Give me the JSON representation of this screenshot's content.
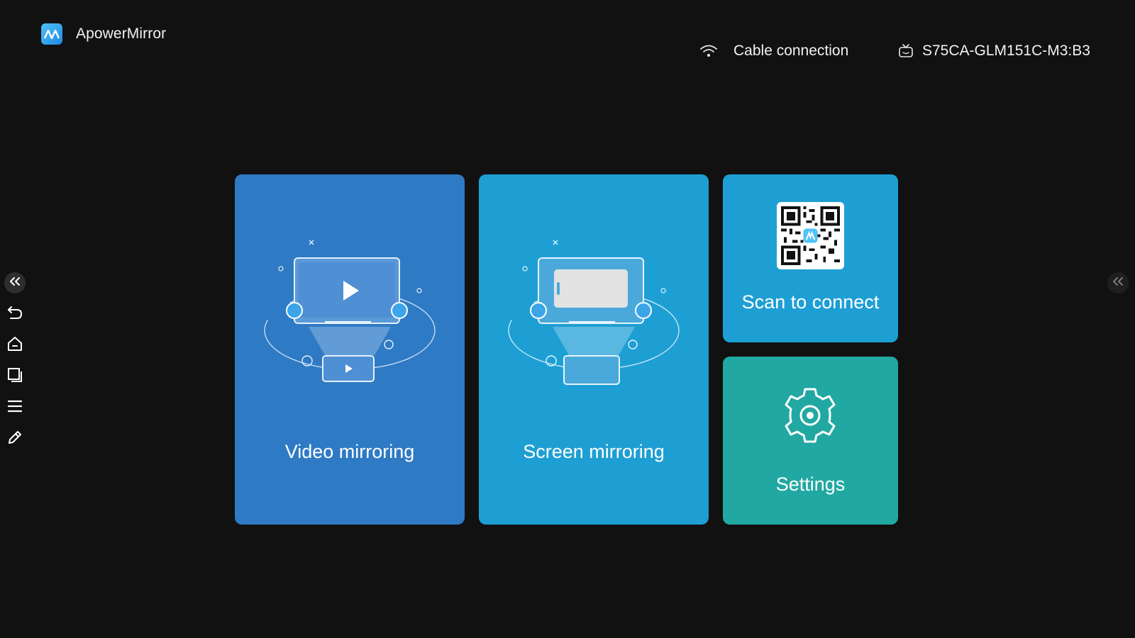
{
  "app": {
    "title": "ApowerMirror",
    "logo_icon": "apowermirror-logo-icon"
  },
  "status": {
    "connection_label": "Cable connection",
    "connection_icon": "wifi-icon",
    "device_name": "S75CA-GLM151C-M3:B3",
    "device_icon": "tv-icon"
  },
  "toolbar": {
    "items": [
      {
        "name": "collapse-left",
        "icon": "double-chevron-left-icon"
      },
      {
        "name": "back",
        "icon": "back-arrow-icon"
      },
      {
        "name": "home",
        "icon": "home-icon"
      },
      {
        "name": "recent-apps",
        "icon": "recent-apps-icon"
      },
      {
        "name": "menu",
        "icon": "menu-icon"
      },
      {
        "name": "annotate",
        "icon": "pencil-icon"
      }
    ],
    "right_collapse_icon": "double-chevron-left-icon"
  },
  "cards": {
    "video": {
      "label": "Video mirroring"
    },
    "screen": {
      "label": "Screen mirroring"
    },
    "scan": {
      "label": "Scan to connect"
    },
    "settings": {
      "label": "Settings"
    }
  },
  "colors": {
    "background": "#111111",
    "video_card": "#2f7ac4",
    "screen_card": "#1e9fd4",
    "scan_card": "#1e9fd4",
    "settings_card": "#22a8a2"
  }
}
